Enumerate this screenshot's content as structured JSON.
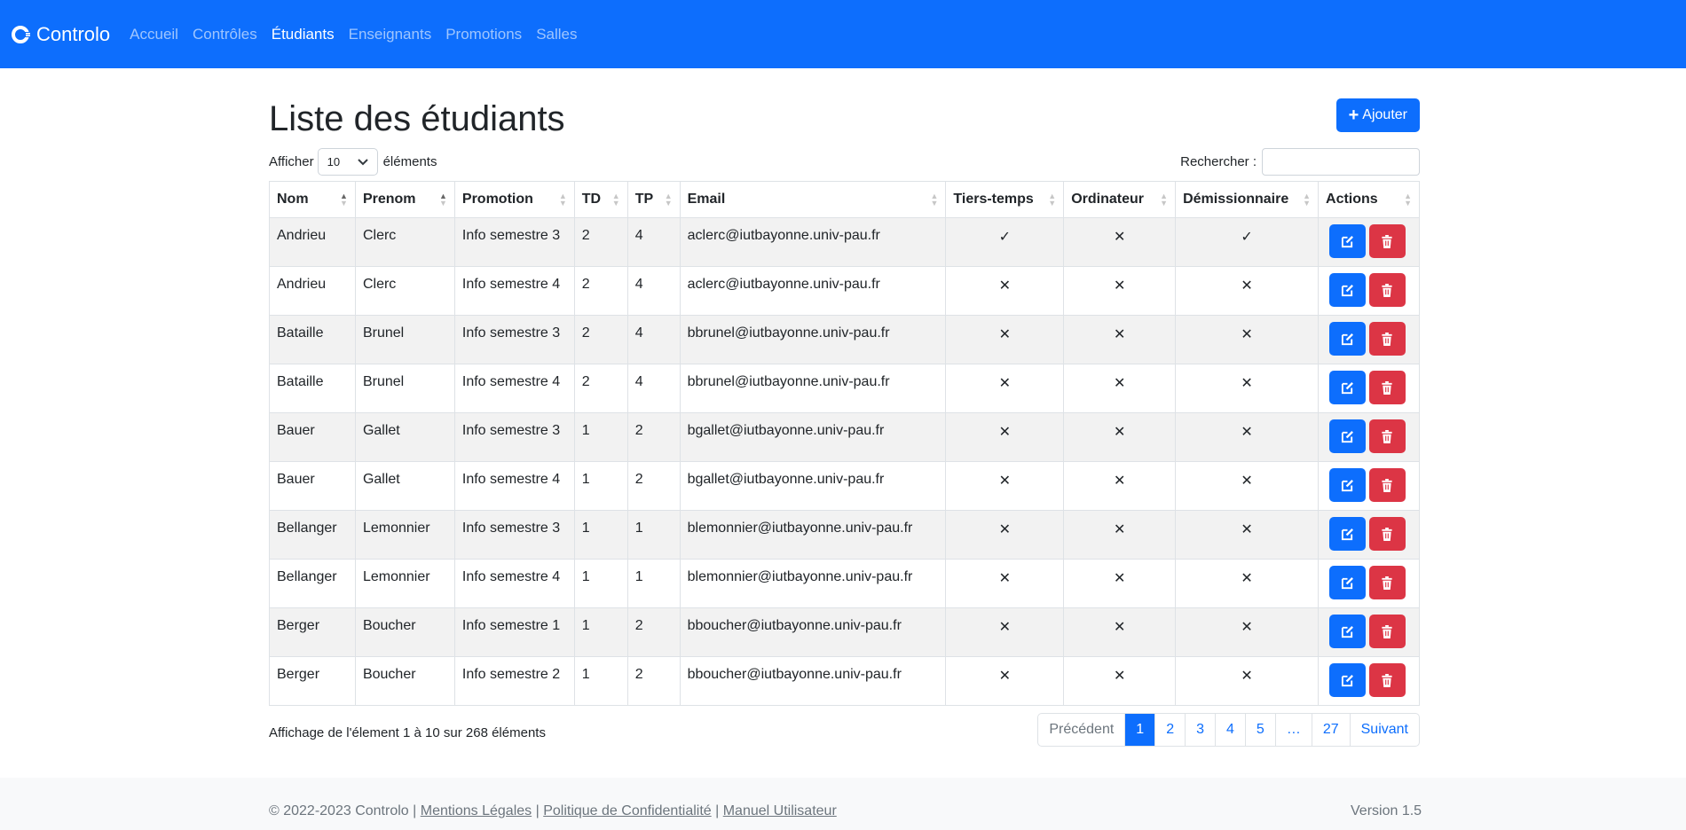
{
  "nav": {
    "brand": "Controlo",
    "links": [
      "Accueil",
      "Contrôles",
      "Étudiants",
      "Enseignants",
      "Promotions",
      "Salles"
    ],
    "active_index": 2
  },
  "page": {
    "title": "Liste des étudiants",
    "add_label": "Ajouter",
    "length_prefix": "Afficher",
    "length_value": "10",
    "length_suffix": "éléments",
    "search_label": "Rechercher :",
    "search_value": ""
  },
  "table": {
    "columns": [
      "Nom",
      "Prenom",
      "Promotion",
      "TD",
      "TP",
      "Email",
      "Tiers-temps",
      "Ordinateur",
      "Démissionnaire",
      "Actions"
    ],
    "rows": [
      {
        "nom": "Andrieu",
        "prenom": "Clerc",
        "promotion": "Info semestre 3",
        "td": "2",
        "tp": "4",
        "email": "aclerc@iutbayonne.univ-pau.fr",
        "tiers": "✓",
        "ordi": "✕",
        "demi": "✓"
      },
      {
        "nom": "Andrieu",
        "prenom": "Clerc",
        "promotion": "Info semestre 4",
        "td": "2",
        "tp": "4",
        "email": "aclerc@iutbayonne.univ-pau.fr",
        "tiers": "✕",
        "ordi": "✕",
        "demi": "✕"
      },
      {
        "nom": "Bataille",
        "prenom": "Brunel",
        "promotion": "Info semestre 3",
        "td": "2",
        "tp": "4",
        "email": "bbrunel@iutbayonne.univ-pau.fr",
        "tiers": "✕",
        "ordi": "✕",
        "demi": "✕"
      },
      {
        "nom": "Bataille",
        "prenom": "Brunel",
        "promotion": "Info semestre 4",
        "td": "2",
        "tp": "4",
        "email": "bbrunel@iutbayonne.univ-pau.fr",
        "tiers": "✕",
        "ordi": "✕",
        "demi": "✕"
      },
      {
        "nom": "Bauer",
        "prenom": "Gallet",
        "promotion": "Info semestre 3",
        "td": "1",
        "tp": "2",
        "email": "bgallet@iutbayonne.univ-pau.fr",
        "tiers": "✕",
        "ordi": "✕",
        "demi": "✕"
      },
      {
        "nom": "Bauer",
        "prenom": "Gallet",
        "promotion": "Info semestre 4",
        "td": "1",
        "tp": "2",
        "email": "bgallet@iutbayonne.univ-pau.fr",
        "tiers": "✕",
        "ordi": "✕",
        "demi": "✕"
      },
      {
        "nom": "Bellanger",
        "prenom": "Lemonnier",
        "promotion": "Info semestre 3",
        "td": "1",
        "tp": "1",
        "email": "blemonnier@iutbayonne.univ-pau.fr",
        "tiers": "✕",
        "ordi": "✕",
        "demi": "✕"
      },
      {
        "nom": "Bellanger",
        "prenom": "Lemonnier",
        "promotion": "Info semestre 4",
        "td": "1",
        "tp": "1",
        "email": "blemonnier@iutbayonne.univ-pau.fr",
        "tiers": "✕",
        "ordi": "✕",
        "demi": "✕"
      },
      {
        "nom": "Berger",
        "prenom": "Boucher",
        "promotion": "Info semestre 1",
        "td": "1",
        "tp": "2",
        "email": "bboucher@iutbayonne.univ-pau.fr",
        "tiers": "✕",
        "ordi": "✕",
        "demi": "✕"
      },
      {
        "nom": "Berger",
        "prenom": "Boucher",
        "promotion": "Info semestre 2",
        "td": "1",
        "tp": "2",
        "email": "bboucher@iutbayonne.univ-pau.fr",
        "tiers": "✕",
        "ordi": "✕",
        "demi": "✕"
      }
    ]
  },
  "info": "Affichage de l'élement 1 à 10 sur 268 éléments",
  "pagination": [
    "Précédent",
    "1",
    "2",
    "3",
    "4",
    "5",
    "…",
    "27",
    "Suivant"
  ],
  "pagination_active": "1",
  "footer": {
    "copyright": "© 2022-2023 Controlo |",
    "links": [
      "Mentions Légales",
      "Politique de Confidentialité",
      "Manuel Utilisateur"
    ],
    "version": "Version 1.5"
  },
  "colors": {
    "primary": "#0d6efd",
    "danger": "#dc3545"
  }
}
